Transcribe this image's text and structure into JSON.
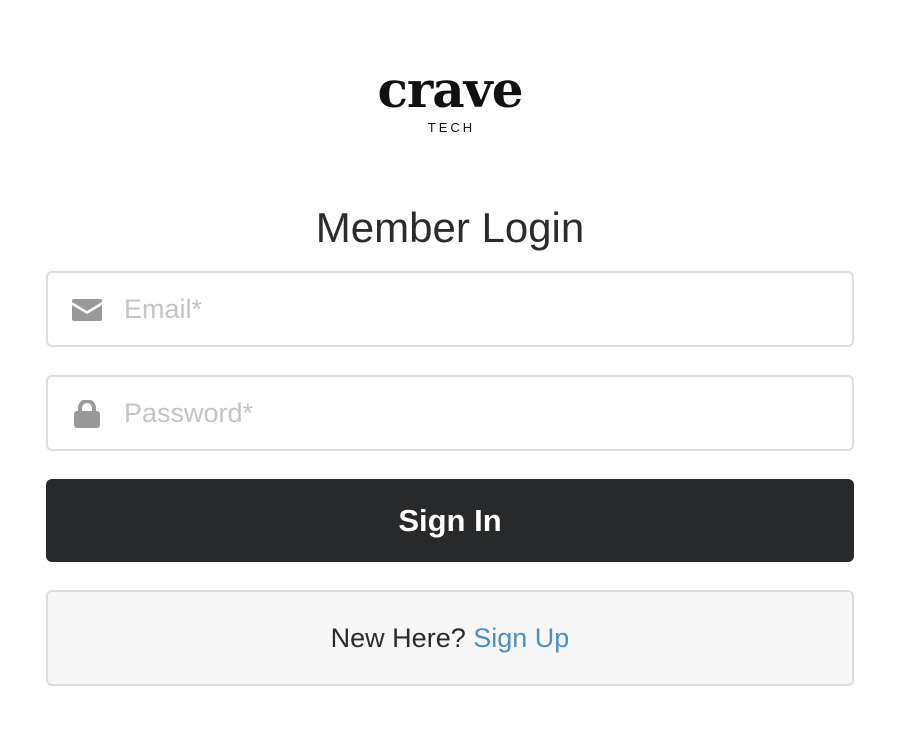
{
  "logo": {
    "wordmark": "crave",
    "subtitle": "TECH"
  },
  "login": {
    "title": "Member Login",
    "email": {
      "placeholder": "Email*",
      "value": "",
      "icon": "envelope-icon"
    },
    "password": {
      "placeholder": "Password*",
      "value": "",
      "icon": "lock-icon"
    },
    "signin_label": "Sign In"
  },
  "signup": {
    "prompt": "New Here?",
    "link_label": "Sign Up"
  },
  "colors": {
    "button_bg": "#28292b",
    "link": "#4a90c4",
    "border": "#dddddd",
    "icon": "#999999",
    "placeholder": "#c4c4c4"
  }
}
